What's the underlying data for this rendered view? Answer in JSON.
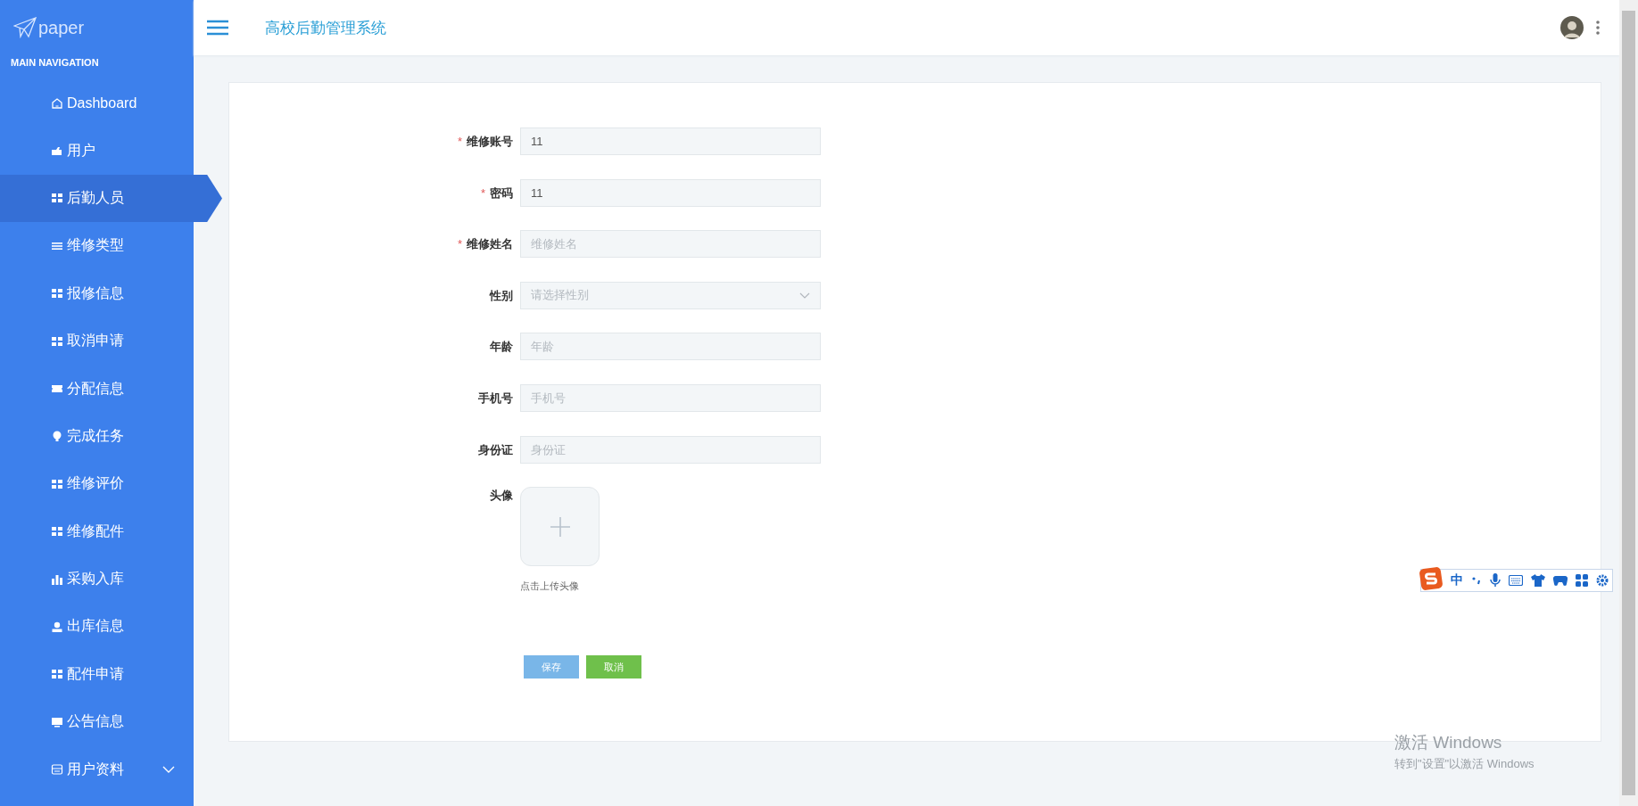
{
  "sidebar": {
    "logo": "paper",
    "heading": "MAIN NAVIGATION",
    "items": [
      {
        "label": "Dashboard",
        "kind": "home",
        "selected": false
      },
      {
        "label": "用户",
        "kind": "card",
        "selected": false
      },
      {
        "label": "后勤人员",
        "kind": "grid",
        "selected": true
      },
      {
        "label": "维修类型",
        "kind": "list",
        "selected": false
      },
      {
        "label": "报修信息",
        "kind": "grid",
        "selected": false
      },
      {
        "label": "取消申请",
        "kind": "grid",
        "selected": false
      },
      {
        "label": "分配信息",
        "kind": "ticket",
        "selected": false
      },
      {
        "label": "完成任务",
        "kind": "bulb",
        "selected": false
      },
      {
        "label": "维修评价",
        "kind": "grid",
        "selected": false
      },
      {
        "label": "维修配件",
        "kind": "grid",
        "selected": false
      },
      {
        "label": "采购入库",
        "kind": "bars",
        "selected": false
      },
      {
        "label": "出库信息",
        "kind": "person",
        "selected": false
      },
      {
        "label": "配件申请",
        "kind": "grid",
        "selected": false
      },
      {
        "label": "公告信息",
        "kind": "monitor",
        "selected": false
      },
      {
        "label": "用户资料",
        "kind": "form",
        "selected": false,
        "expanded": false
      }
    ]
  },
  "header": {
    "title": "高校后勤管理系统"
  },
  "form": {
    "fields": [
      {
        "kind": "input",
        "required_mark": "*",
        "label": "维修账号",
        "value": "11"
      },
      {
        "kind": "input",
        "required_mark": "*",
        "label": "密码",
        "value": "11"
      },
      {
        "kind": "input",
        "required_mark": "*",
        "label": "维修姓名",
        "placeholder": "维修姓名"
      },
      {
        "kind": "select",
        "label": "性别",
        "placeholder": "请选择性别"
      },
      {
        "kind": "input",
        "label": "年龄",
        "placeholder": "年龄"
      },
      {
        "kind": "input",
        "label": "手机号",
        "placeholder": "手机号"
      },
      {
        "kind": "input",
        "label": "身份证",
        "placeholder": "身份证"
      }
    ],
    "upload": {
      "label": "头像",
      "hint": "点击上传头像"
    },
    "buttons": [
      {
        "kind": "primary",
        "label": "保存"
      },
      {
        "kind": "success",
        "label": "取消"
      }
    ]
  },
  "ime_toolbar": {
    "mode": "中"
  },
  "activation": {
    "title": "激活 Windows",
    "subtitle": "转到\"设置\"以激活 Windows"
  }
}
